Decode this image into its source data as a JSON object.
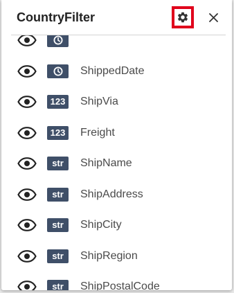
{
  "header": {
    "title": "CountryFilter",
    "settings_icon": "gear-icon",
    "close_icon": "close-icon"
  },
  "colors": {
    "badge_bg": "#3f4f68",
    "highlight_border": "#e0001b",
    "label_text": "#4a4a4a"
  },
  "fields": [
    {
      "name": "",
      "type": "date",
      "type_label": "",
      "visibility_icon": "eye-icon"
    },
    {
      "name": "ShippedDate",
      "type": "date",
      "type_label": "",
      "visibility_icon": "eye-icon"
    },
    {
      "name": "ShipVia",
      "type": "number",
      "type_label": "123",
      "visibility_icon": "eye-icon"
    },
    {
      "name": "Freight",
      "type": "number",
      "type_label": "123",
      "visibility_icon": "eye-icon"
    },
    {
      "name": "ShipName",
      "type": "string",
      "type_label": "str",
      "visibility_icon": "eye-icon"
    },
    {
      "name": "ShipAddress",
      "type": "string",
      "type_label": "str",
      "visibility_icon": "eye-icon"
    },
    {
      "name": "ShipCity",
      "type": "string",
      "type_label": "str",
      "visibility_icon": "eye-icon"
    },
    {
      "name": "ShipRegion",
      "type": "string",
      "type_label": "str",
      "visibility_icon": "eye-icon"
    },
    {
      "name": "ShipPostalCode",
      "type": "string",
      "type_label": "str",
      "visibility_icon": "eye-icon"
    }
  ]
}
